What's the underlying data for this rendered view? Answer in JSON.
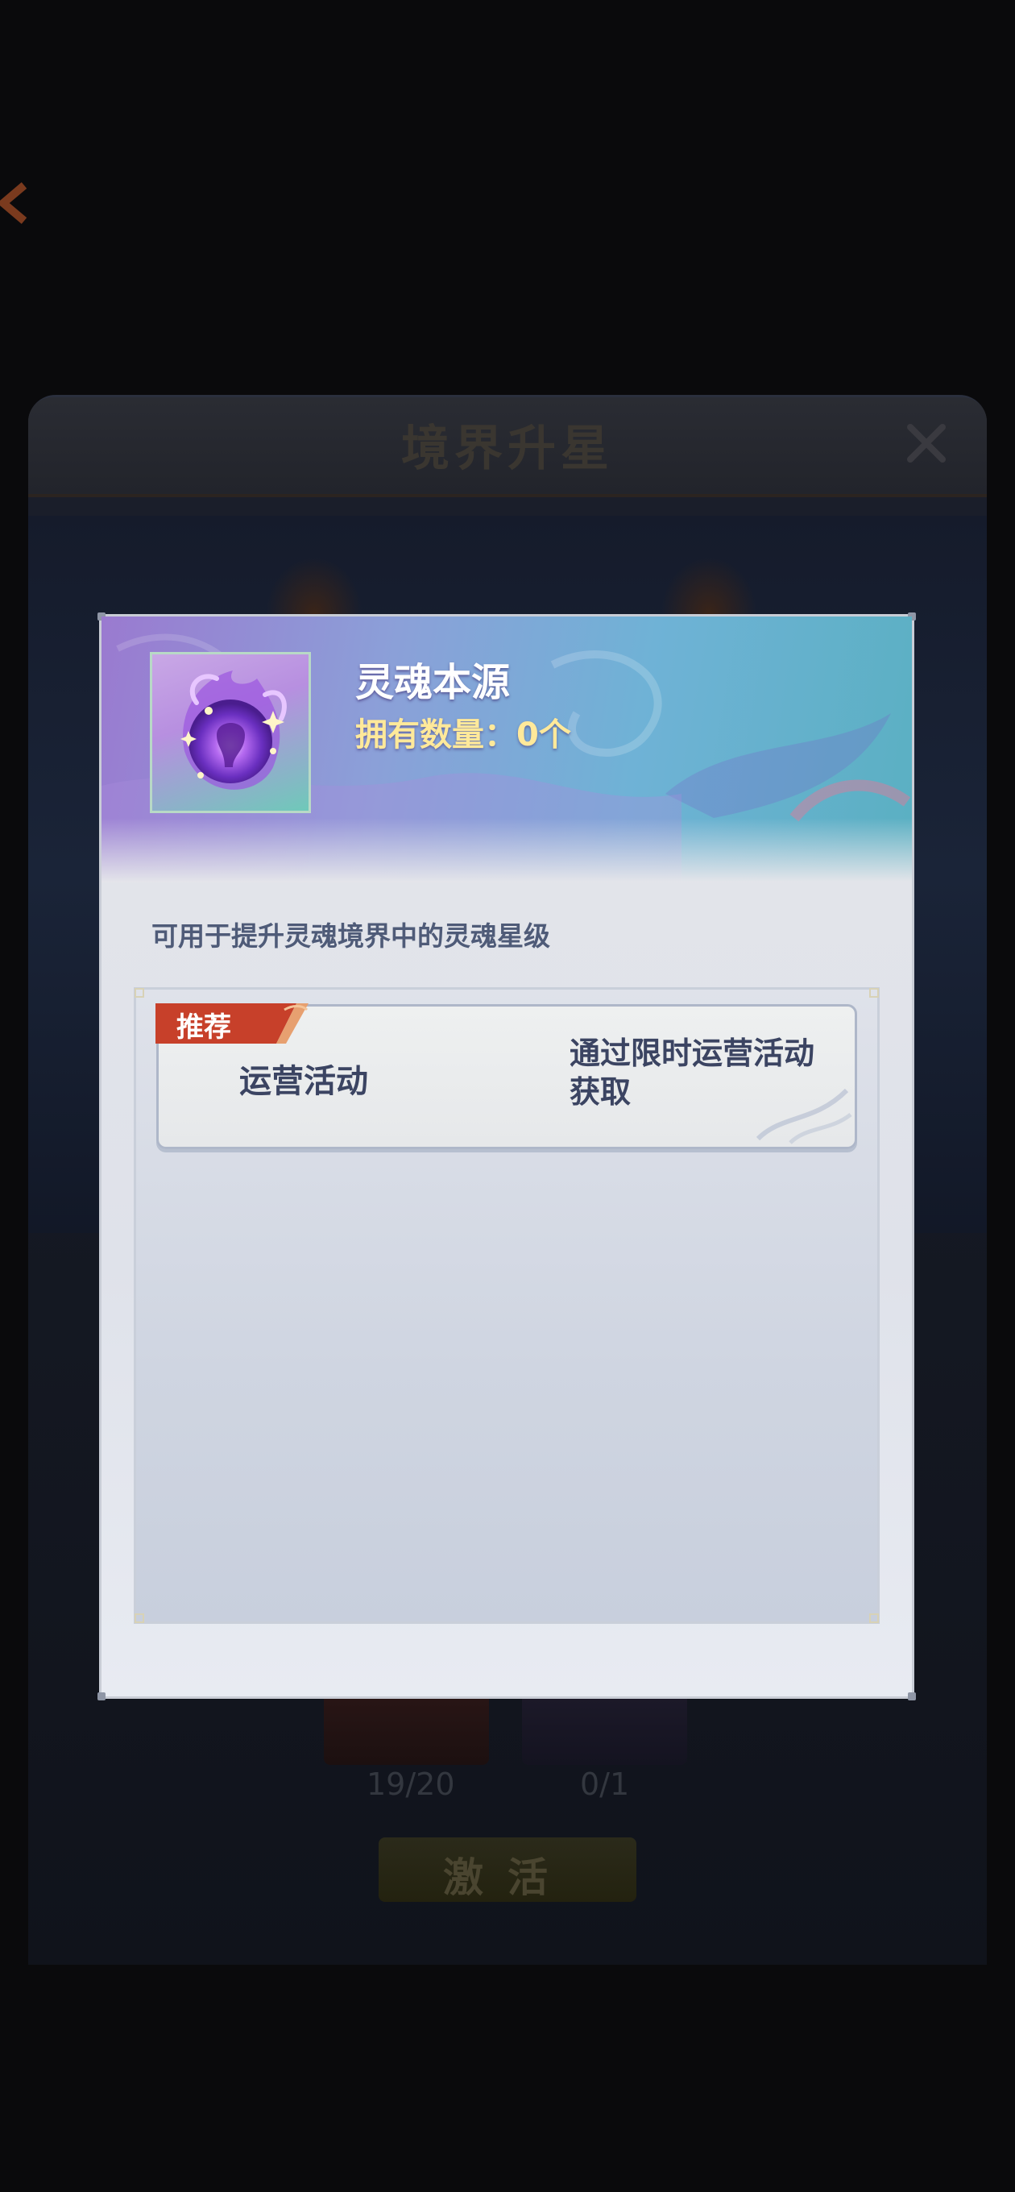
{
  "background": {
    "title": "境界升星",
    "counts": [
      "19/20",
      "0/1"
    ],
    "activate_label": "激活"
  },
  "popup": {
    "item_name": "灵魂本源",
    "owned_text": "拥有数量：0个",
    "description": "可用于提升灵魂境界中的灵魂星级",
    "sources": [
      {
        "tag": "推荐",
        "name": "运营活动",
        "how": "通过限时运营活动获取"
      }
    ]
  },
  "colors": {
    "tag_red": "#c7402a",
    "owned_yellow": "#ffe99a",
    "text_navy": "#3b4462"
  },
  "icons": {
    "item": "purple-soul-flame-icon",
    "back": "back-arrow-icon",
    "close": "close-icon"
  }
}
